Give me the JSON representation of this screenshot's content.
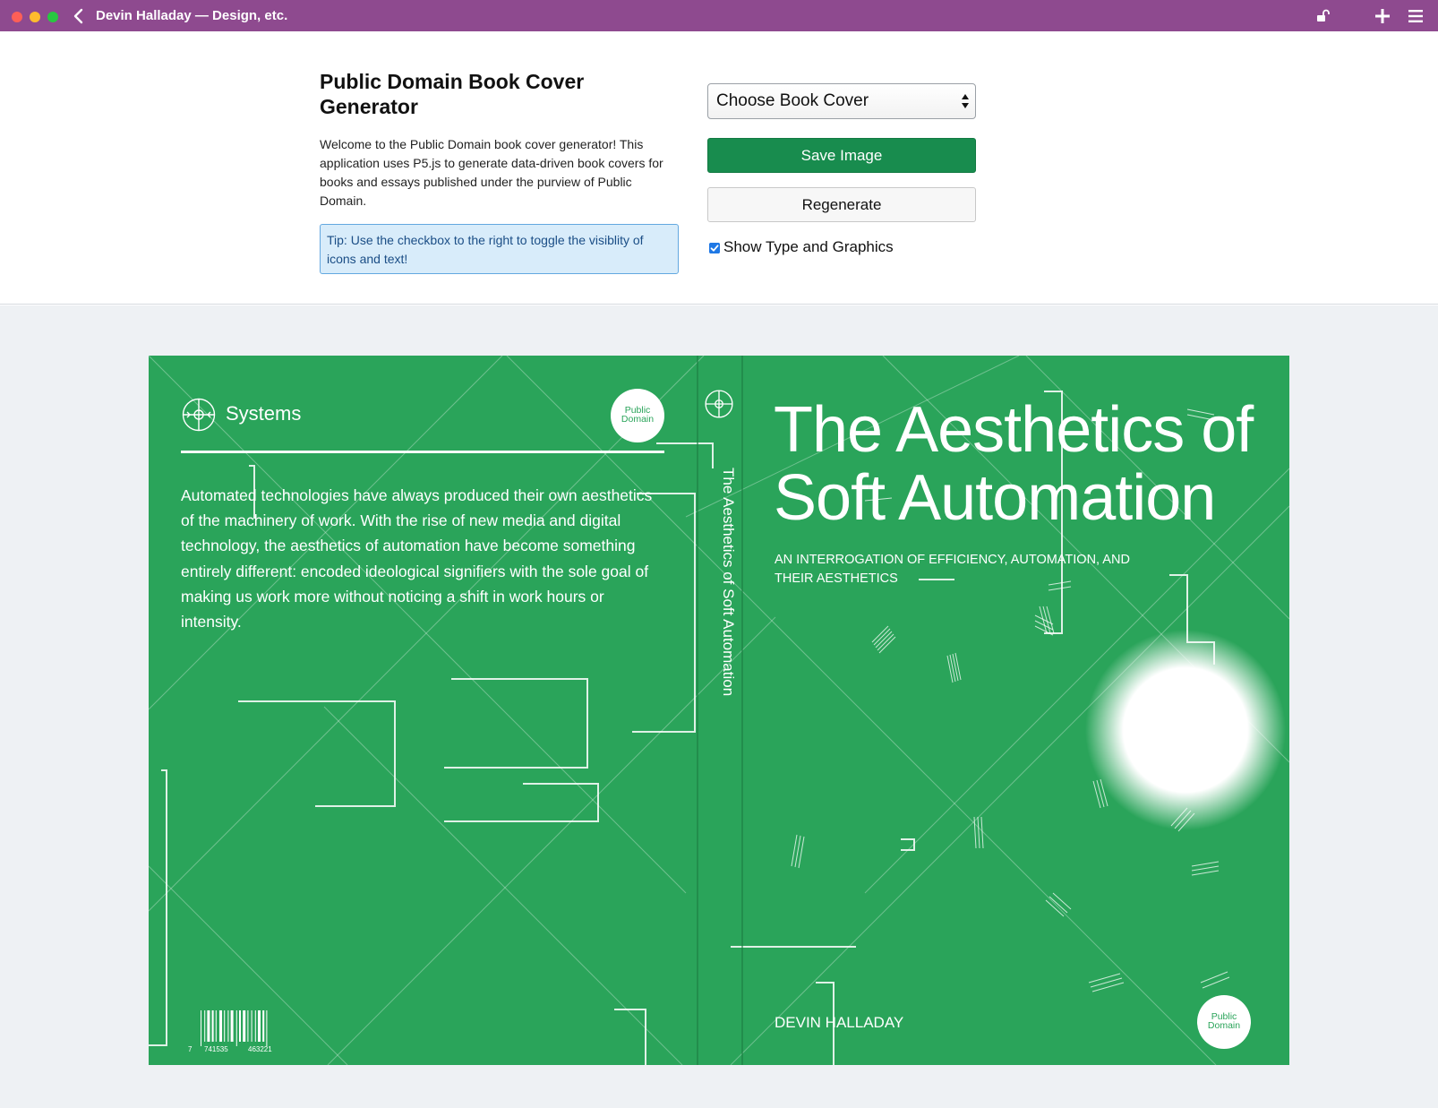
{
  "window": {
    "title": "Devin Halladay — Design, etc."
  },
  "controls": {
    "app_title": "Public Domain Book Cover Generator",
    "intro": "Welcome to the Public Domain book cover generator! This application uses P5.js to generate data-driven book covers for books and essays published under the purview of Public Domain.",
    "tip": "Tip: Use the checkbox to the right to toggle the visiblity of icons and text!",
    "select_value": "Choose Book Cover",
    "save_label": "Save Image",
    "regenerate_label": "Regenerate",
    "checkbox_label": "Show Type and Graphics",
    "checkbox_checked": true
  },
  "cover": {
    "background_color": "#2aa45a",
    "category": "Systems",
    "publisher_line1": "Public",
    "publisher_line2": "Domain",
    "blurb": "Automated technologies have always produced their own aesthetics of the machinery of work. With the rise of new media and digital technology, the aesthetics of automation have become something entirely different: encoded ideological signifiers with the sole goal of making us work more without noticing a shift in work hours or intensity.",
    "spine_title": "The Aesthetics of Soft Automation",
    "title": "The Aesthetics of Soft Automation",
    "subtitle": "AN INTERROGATION OF EFFICIENCY, AUTOMATION, AND THEIR AESTHETICS",
    "author": "DEVIN HALLADAY",
    "barcode_digits": [
      "7",
      "741535",
      "463221"
    ]
  },
  "colors": {
    "titlebar": "#8e4a8f",
    "save_button": "#188c4e",
    "tip_bg": "#d8ecfa",
    "tip_border": "#63a8e0",
    "cover_green": "#2aa45a"
  }
}
